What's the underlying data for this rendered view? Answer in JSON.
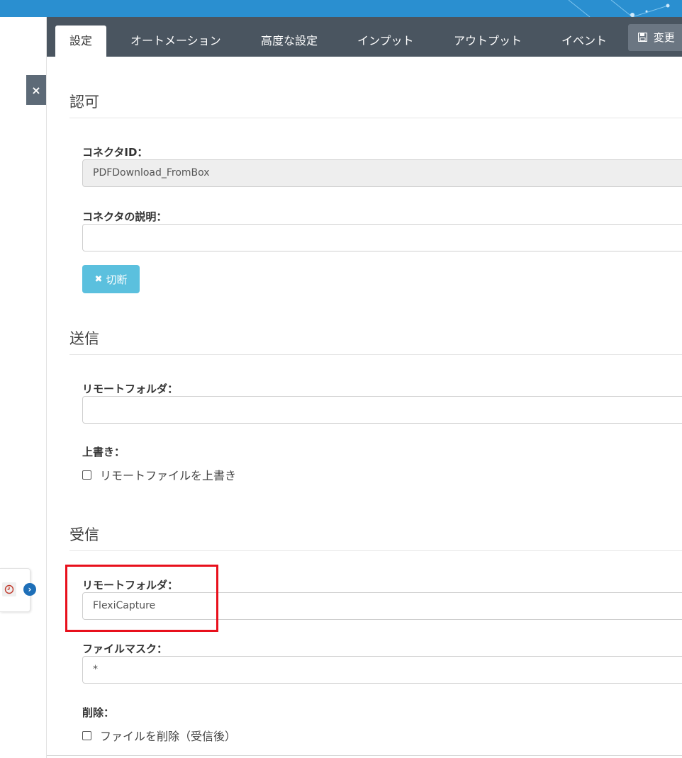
{
  "tabs": [
    {
      "label": "設定",
      "active": true
    },
    {
      "label": "オートメーション",
      "active": false
    },
    {
      "label": "高度な設定",
      "active": false
    },
    {
      "label": "インプット",
      "active": false
    },
    {
      "label": "アウトプット",
      "active": false
    },
    {
      "label": "イベント",
      "active": false
    }
  ],
  "toolbar": {
    "save_label": "変更"
  },
  "auth": {
    "title": "認可",
    "connector_id_label": "コネクタID：",
    "connector_id_value": "PDFDownload_FromBox",
    "description_label": "コネクタの説明：",
    "description_value": "",
    "disconnect_label": "切断"
  },
  "send": {
    "title": "送信",
    "remote_folder_label": "リモートフォルダ：",
    "remote_folder_value": "",
    "overwrite_label": "上書き：",
    "overwrite_checkbox_label": "リモートファイルを上書き"
  },
  "receive": {
    "title": "受信",
    "remote_folder_label": "リモートフォルダ：",
    "remote_folder_value": "FlexiCapture",
    "file_mask_label": "ファイルマスク：",
    "file_mask_value": "*",
    "delete_label": "削除：",
    "delete_checkbox_label": "ファイルを削除（受信後）"
  },
  "colors": {
    "topbar": "#2a8fd0",
    "tabbar": "#4a5560",
    "disconnect_button": "#5bc0de",
    "highlight": "#e8101c"
  },
  "icons": {
    "close": "close-icon",
    "save": "floppy-disk-icon",
    "disconnect": "x-icon",
    "history": "clock-icon",
    "expand": "chevron-right-icon"
  }
}
